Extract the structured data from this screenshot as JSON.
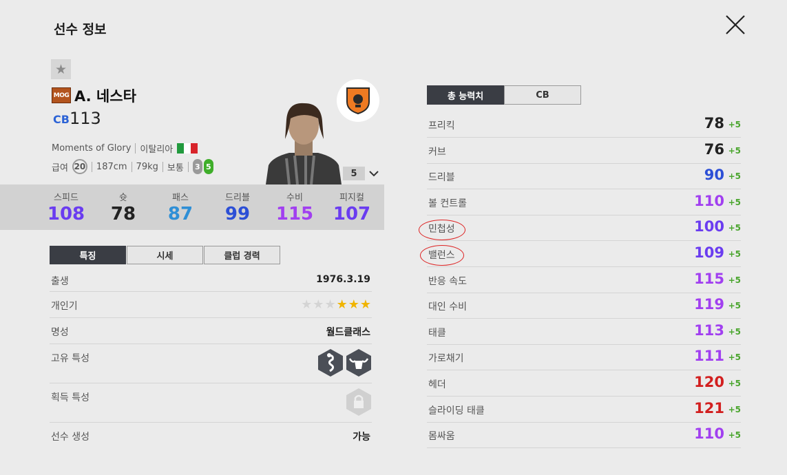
{
  "header": {
    "title": "선수 정보"
  },
  "player": {
    "season_badge": "MOG",
    "name": "A. 네스타",
    "position": "CB",
    "overall": "113",
    "season": "Moments of Glory",
    "nationality": "이탈리아",
    "wage_label": "급여",
    "wage": "20",
    "height": "187cm",
    "weight": "79kg",
    "body_type": "보통",
    "weak_foot": "3",
    "strong_foot": "5",
    "upgrade_level": "5"
  },
  "summary_stats": [
    {
      "label": "스피드",
      "value": "108",
      "color": "#6a3cf0"
    },
    {
      "label": "슛",
      "value": "78",
      "color": "#222222"
    },
    {
      "label": "패스",
      "value": "87",
      "color": "#2f8fd6"
    },
    {
      "label": "드리블",
      "value": "99",
      "color": "#2c4fd6"
    },
    {
      "label": "수비",
      "value": "115",
      "color": "#a13ff0"
    },
    {
      "label": "피지컬",
      "value": "107",
      "color": "#6a3cf0"
    }
  ],
  "left_tabs": [
    "특징",
    "시세",
    "클럽 경력"
  ],
  "info_rows": {
    "birth": {
      "label": "출생",
      "value": "1976.3.19"
    },
    "popularity": {
      "label": "개인기",
      "stars_filled": 3,
      "stars_total": 6
    },
    "reputation": {
      "label": "명성",
      "value": "월드클래스"
    },
    "unique_traits": {
      "label": "고유 특성",
      "icons": [
        "snake-icon",
        "bull-icon"
      ]
    },
    "acquired_traits": {
      "label": "획득 특성",
      "icons": [
        "lock-icon"
      ]
    },
    "creation": {
      "label": "선수 생성",
      "value": "가능"
    }
  },
  "right_tabs": [
    "총 능력치",
    "CB"
  ],
  "attributes": [
    {
      "label": "프리킥",
      "value": "78",
      "bonus": "+5",
      "color": "#222222"
    },
    {
      "label": "커브",
      "value": "76",
      "bonus": "+5",
      "color": "#222222"
    },
    {
      "label": "드리블",
      "value": "90",
      "bonus": "+5",
      "color": "#2c4fd6"
    },
    {
      "label": "볼 컨트롤",
      "value": "110",
      "bonus": "+5",
      "color": "#a13ff0"
    },
    {
      "label": "민첩성",
      "value": "100",
      "bonus": "+5",
      "color": "#6a3cf0"
    },
    {
      "label": "밸런스",
      "value": "109",
      "bonus": "+5",
      "color": "#6a3cf0"
    },
    {
      "label": "반응 속도",
      "value": "115",
      "bonus": "+5",
      "color": "#a13ff0"
    },
    {
      "label": "대인 수비",
      "value": "119",
      "bonus": "+5",
      "color": "#a13ff0"
    },
    {
      "label": "태클",
      "value": "113",
      "bonus": "+5",
      "color": "#a13ff0"
    },
    {
      "label": "가로채기",
      "value": "111",
      "bonus": "+5",
      "color": "#a13ff0"
    },
    {
      "label": "헤더",
      "value": "120",
      "bonus": "+5",
      "color": "#d21f1f"
    },
    {
      "label": "슬라이딩 태클",
      "value": "121",
      "bonus": "+5",
      "color": "#d21f1f"
    },
    {
      "label": "몸싸움",
      "value": "110",
      "bonus": "+5",
      "color": "#a13ff0"
    }
  ]
}
